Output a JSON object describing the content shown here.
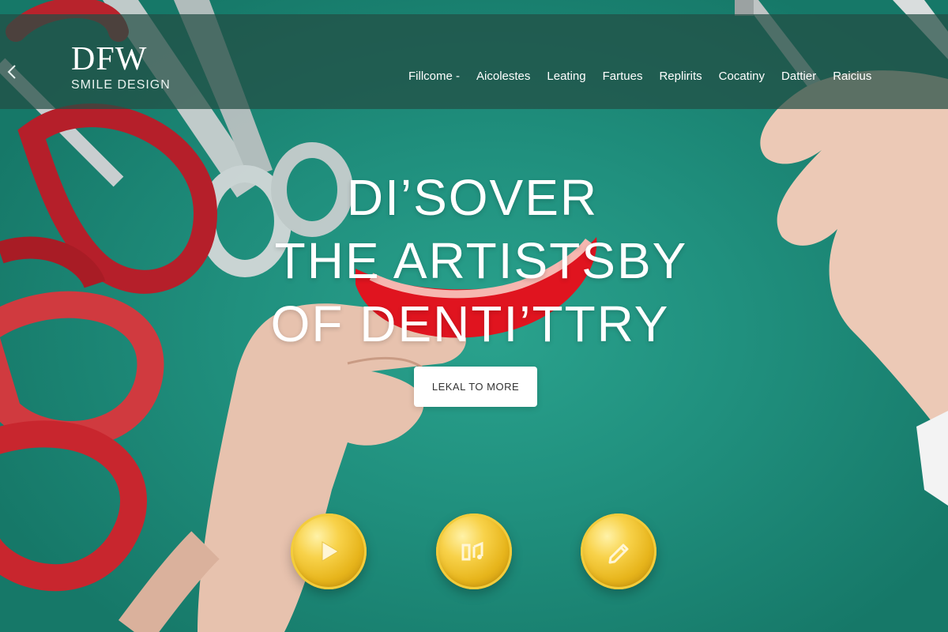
{
  "logo": {
    "main": "DFW",
    "sub": "SMILE DESIGN"
  },
  "nav": {
    "back_icon": "chevron-left-icon",
    "links": [
      "Fillcome -",
      "Aicolestes",
      "Leating",
      "Fartues",
      "Replirits",
      "Cocatiny",
      "Dattier",
      "Raicius"
    ]
  },
  "hero": {
    "headline_lines": [
      "DI’SOVER",
      "THE ARTISTSBY",
      "OF DENTI’TTRY"
    ],
    "cta_label": "LEKAL TO MORE"
  },
  "feature_buttons": [
    {
      "icon": "play-icon"
    },
    {
      "icon": "music-note-icon"
    },
    {
      "icon": "pencil-icon"
    }
  ],
  "colors": {
    "background": "#1f8c7b",
    "nav_overlay": "#234e44",
    "coin_gold": "#f0c32c",
    "cta_bg": "#ffffff"
  }
}
